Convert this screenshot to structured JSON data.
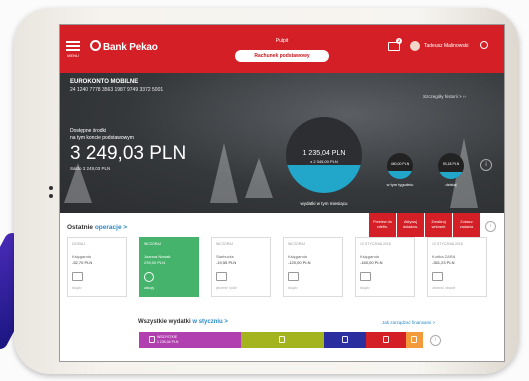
{
  "header": {
    "menu_label": "MENU",
    "logo_text": "Bank Pekao",
    "page_title": "Pulpit",
    "account_button": "Rachunek podstawowy",
    "mail_badge": "2",
    "user_name": "Tadeusz Malinowski"
  },
  "account": {
    "name": "EUROKONTO MOBILNE",
    "number": "24 1240 7778 3563 1987 9749 3372 5001",
    "available_label_1": "Dostępne środki",
    "available_label_2": "na tym koncie podstawowym",
    "available_amount": "3 249,03 PLN",
    "saldo": "Saldo 3 249,03 PLN",
    "history_link": "Szczegóły historii  >  ››"
  },
  "spending": {
    "main_amount": "1 235,04 PLN",
    "main_sub": "z 2 345,00 PLN",
    "main_label": "wydatki w tym miesiącu",
    "week_amount": "460,00 PLN",
    "week_label": "w tym tygodniu",
    "today_amount": "93,18 PLN",
    "today_label": "dzisiaj"
  },
  "actions": [
    {
      "label": "Przelew do zdefin."
    },
    {
      "label": "Aktywuj doładow."
    },
    {
      "label": "Zrealizuj wniosek"
    },
    {
      "label": "Zobacz zadania"
    }
  ],
  "operations": {
    "title": "Ostatnie",
    "link": "operacje >",
    "cards": [
      {
        "date": "DZISIAJ",
        "name": "Księgarnia",
        "amount": "-52,70 PLN",
        "category": "książki",
        "highlight": false
      },
      {
        "date": "WCZORAJ",
        "name": "Joanna Nowak",
        "amount": "239,00 PLN",
        "category": "zakupy",
        "highlight": true
      },
      {
        "date": "WCZORAJ",
        "name": "Starbucks",
        "amount": "-19,55 PLN",
        "category": "jedzenie i picie",
        "highlight": false
      },
      {
        "date": "WCZORAJ",
        "name": "Księgarnia",
        "amount": "-120,00 PLN",
        "category": "książki",
        "highlight": false
      },
      {
        "date": "12 STYCZNIA 2018",
        "name": "Księgarnia",
        "amount": "-160,00 PLN",
        "category": "książki",
        "highlight": false
      },
      {
        "date": "12 STYCZNIA 2018",
        "name": "Kurtka ZARA",
        "amount": "-351,23 PLN",
        "category": "ubrania i obuwie",
        "highlight": false
      }
    ]
  },
  "expenses": {
    "title": "Wszystkie wydatki",
    "month_link": "w styczniu >",
    "finance_link": "Jak zarządzać finansami >",
    "first_segment_label": "WSZYSTKIE",
    "first_segment_amount": "1 235,04 PLN",
    "segments": [
      {
        "color": "#b23fb0",
        "share": 0.36
      },
      {
        "color": "#a3b41f",
        "share": 0.29
      },
      {
        "color": "#2b2e9e",
        "share": 0.15
      },
      {
        "color": "#d51f26",
        "share": 0.14
      },
      {
        "color": "#f39a3a",
        "share": 0.06
      }
    ]
  }
}
